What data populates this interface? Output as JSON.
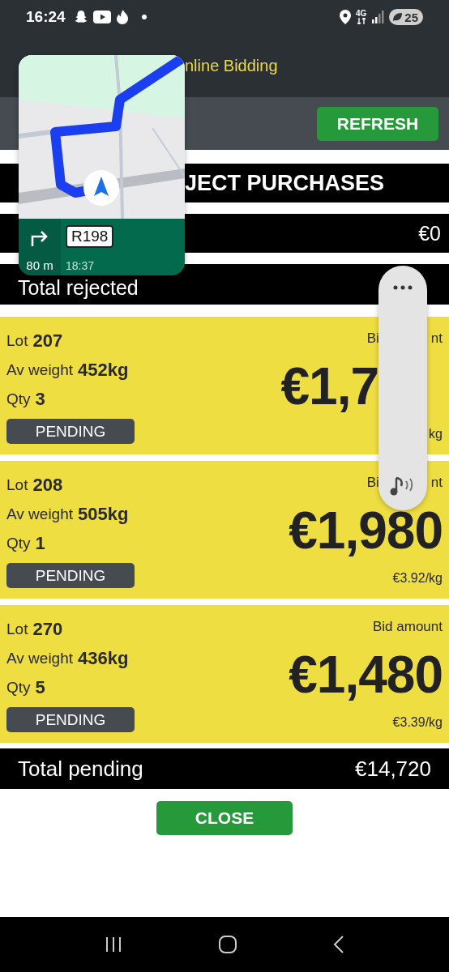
{
  "status_bar": {
    "time": "16:24",
    "network": "4G",
    "battery": "25"
  },
  "header": {
    "title": "nline Bidding"
  },
  "toolbar": {
    "refresh_button": "REFRESH"
  },
  "section_title": "JECT PURCHASES",
  "total_rows": [
    {
      "value": "€0"
    },
    {
      "label": "Total rejected"
    }
  ],
  "lots": [
    {
      "lot_label": "Lot",
      "lot": "207",
      "weight_label": "Av weight",
      "weight": "452kg",
      "qty_label": "Qty",
      "qty": "3",
      "status": "PENDING",
      "bid_label": {
        "text": "Bi",
        "cut": true,
        "after": "nt"
      },
      "amount": {
        "text": "€1,7",
        "cut": true
      },
      "per_kg": {
        "cut": true,
        "after": "kg"
      }
    },
    {
      "lot_label": "Lot",
      "lot": "208",
      "weight_label": "Av weight",
      "weight": "505kg",
      "qty_label": "Qty",
      "qty": "1",
      "status": "PENDING",
      "bid_label": {
        "text": "Bi",
        "cut": true,
        "after": "nt"
      },
      "amount": {
        "text": "€1,980",
        "cut": false
      },
      "per_kg": {
        "text": "€3.92/kg",
        "cut": false
      }
    },
    {
      "lot_label": "Lot",
      "lot": "270",
      "weight_label": "Av weight",
      "weight": "436kg",
      "qty_label": "Qty",
      "qty": "5",
      "status": "PENDING",
      "bid_label": {
        "text": "Bid amount",
        "cut": false
      },
      "amount": {
        "text": "€1,480",
        "cut": false
      },
      "per_kg": {
        "text": "€3.39/kg",
        "cut": false
      }
    }
  ],
  "total_pending": {
    "label": "Total pending",
    "value": "€14,720"
  },
  "close_button": "CLOSE",
  "navigation": {
    "road": "R198",
    "turn_distance": "80 m",
    "arrival": "18:37"
  }
}
